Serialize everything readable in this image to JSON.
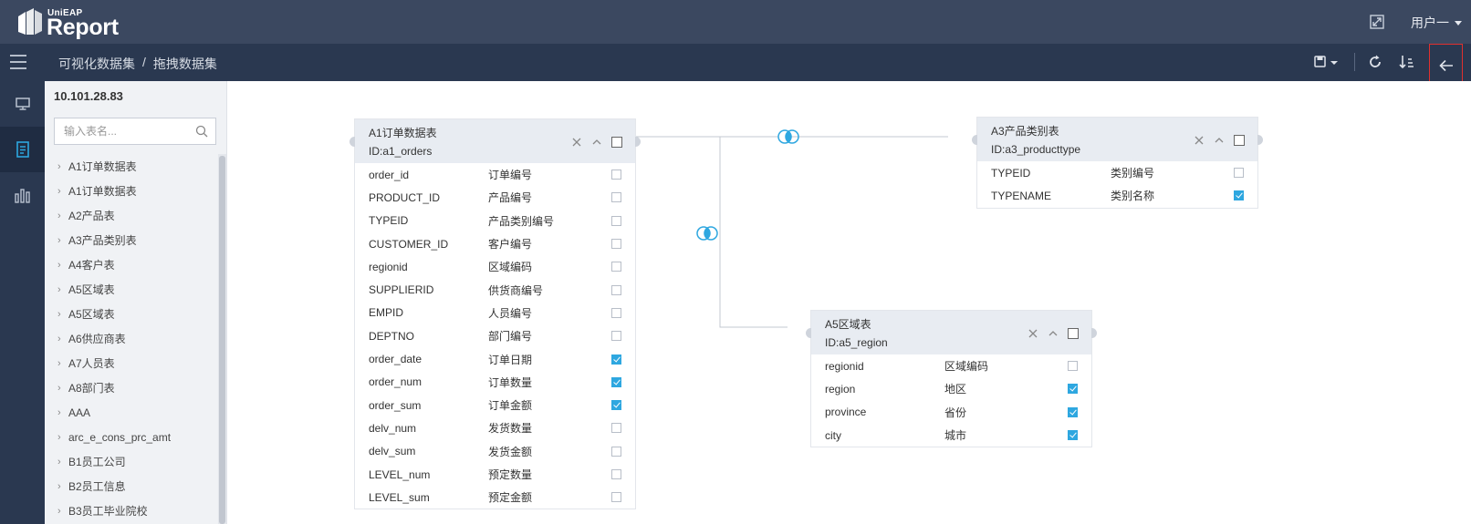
{
  "header": {
    "logo_small": "UniEAP",
    "logo_big": "Report",
    "user_label": "用户一"
  },
  "toolbar": {
    "breadcrumb": [
      "可视化数据集",
      "拖拽数据集"
    ],
    "breadcrumb_sep": "/",
    "tools": [
      "save-icon",
      "refresh-icon",
      "sort-icon",
      "back-arrow-icon"
    ]
  },
  "rail": {
    "items": [
      "monitor-icon",
      "dataset-icon",
      "bar-chart-icon"
    ],
    "active_index": 1
  },
  "tree": {
    "server": "10.101.28.83",
    "search_placeholder": "输入表名...",
    "items": [
      "A1订单数据表",
      "A1订单数据表",
      "A2产品表",
      "A3产品类别表",
      "A4客户表",
      "A5区域表",
      "A5区域表",
      "A6供应商表",
      "A7人员表",
      "A8部门表",
      "AAA",
      "arc_e_cons_prc_amt",
      "B1员工公司",
      "B2员工信息",
      "B3员工毕业院校"
    ]
  },
  "tables": [
    {
      "title": "A1订单数据表",
      "id_label": "ID:a1_orders",
      "fields": [
        {
          "name": "order_id",
          "desc": "订单编号",
          "checked": false
        },
        {
          "name": "PRODUCT_ID",
          "desc": "产品编号",
          "checked": false
        },
        {
          "name": "TYPEID",
          "desc": "产品类别编号",
          "checked": false
        },
        {
          "name": "CUSTOMER_ID",
          "desc": "客户编号",
          "checked": false
        },
        {
          "name": "regionid",
          "desc": "区域编码",
          "checked": false
        },
        {
          "name": "SUPPLIERID",
          "desc": "供货商编号",
          "checked": false
        },
        {
          "name": "EMPID",
          "desc": "人员编号",
          "checked": false
        },
        {
          "name": "DEPTNO",
          "desc": "部门编号",
          "checked": false
        },
        {
          "name": "order_date",
          "desc": "订单日期",
          "checked": true
        },
        {
          "name": "order_num",
          "desc": "订单数量",
          "checked": true
        },
        {
          "name": "order_sum",
          "desc": "订单金额",
          "checked": true
        },
        {
          "name": "delv_num",
          "desc": "发货数量",
          "checked": false
        },
        {
          "name": "delv_sum",
          "desc": "发货金额",
          "checked": false
        },
        {
          "name": "LEVEL_num",
          "desc": "预定数量",
          "checked": false
        },
        {
          "name": "LEVEL_sum",
          "desc": "预定金额",
          "checked": false
        }
      ]
    },
    {
      "title": "A3产品类别表",
      "id_label": "ID:a3_producttype",
      "fields": [
        {
          "name": "TYPEID",
          "desc": "类别编号",
          "checked": false
        },
        {
          "name": "TYPENAME",
          "desc": "类别名称",
          "checked": true
        }
      ]
    },
    {
      "title": "A5区域表",
      "id_label": "ID:a5_region",
      "fields": [
        {
          "name": "regionid",
          "desc": "区域编码",
          "checked": false
        },
        {
          "name": "region",
          "desc": "地区",
          "checked": true
        },
        {
          "name": "province",
          "desc": "省份",
          "checked": true
        },
        {
          "name": "city",
          "desc": "城市",
          "checked": true
        }
      ]
    }
  ],
  "colors": {
    "header_bg": "#3b4860",
    "subbar_bg": "#2a3850",
    "accent": "#2ea7e0",
    "highlight_border": "#e0302e"
  }
}
